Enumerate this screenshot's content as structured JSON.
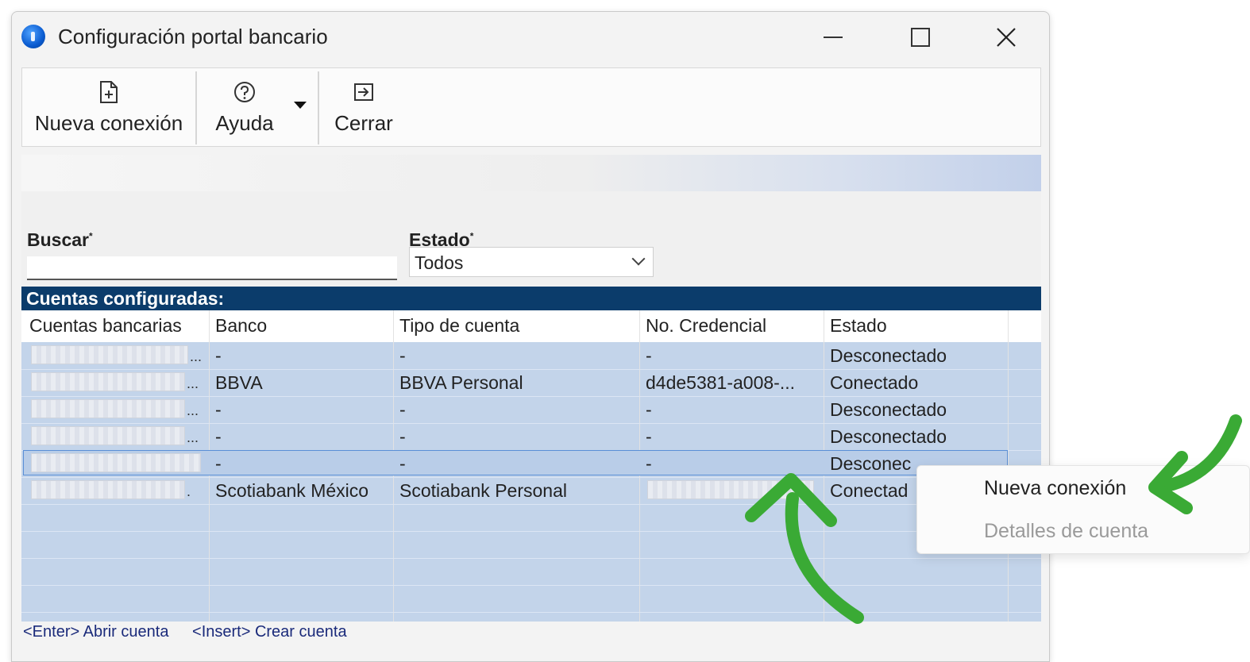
{
  "window": {
    "title": "Configuración portal bancario",
    "controls": {
      "minimize": "—",
      "maximize": "□",
      "close": "✕"
    }
  },
  "toolbar": {
    "new_connection": "Nueva conexión",
    "help": "Ayuda",
    "close": "Cerrar"
  },
  "filters": {
    "search_label": "Buscar",
    "search_value": "",
    "status_label": "Estado",
    "status_value": "Todos",
    "required_mark": "*"
  },
  "grid": {
    "title": "Cuentas configuradas:",
    "columns": [
      "Cuentas bancarias",
      "Banco",
      "Tipo de cuenta",
      "No. Credencial",
      "Estado"
    ],
    "rows": [
      {
        "account": "",
        "bank": "-",
        "type": "-",
        "credential": "-",
        "status": "Desconectado"
      },
      {
        "account": "",
        "bank": "BBVA",
        "type": "BBVA Personal",
        "credential": "d4de5381-a008-...",
        "status": "Conectado"
      },
      {
        "account": "",
        "bank": "-",
        "type": "-",
        "credential": "-",
        "status": "Desconectado"
      },
      {
        "account": "",
        "bank": "-",
        "type": "-",
        "credential": "-",
        "status": "Desconectado"
      },
      {
        "account": "",
        "bank": "-",
        "type": "-",
        "credential": "-",
        "status": "Desconec"
      },
      {
        "account": "",
        "bank": "Scotiabank México",
        "type": "Scotiabank Personal",
        "credential": "",
        "status": "Conectad"
      }
    ]
  },
  "shortcuts": {
    "enter": "<Enter> Abrir cuenta",
    "insert": "<Insert> Crear cuenta"
  },
  "context_menu": {
    "items": [
      "Nueva conexión",
      "Detalles de cuenta"
    ]
  },
  "colors": {
    "grid_title_bg": "#0b3c6b",
    "grid_bg": "#c3d4ea",
    "annotation_arrow": "#3aaa35"
  },
  "icons": [
    "app-icon",
    "new-document-icon",
    "help-icon",
    "exit-icon",
    "dropdown-caret-icon",
    "chevron-down-icon"
  ]
}
